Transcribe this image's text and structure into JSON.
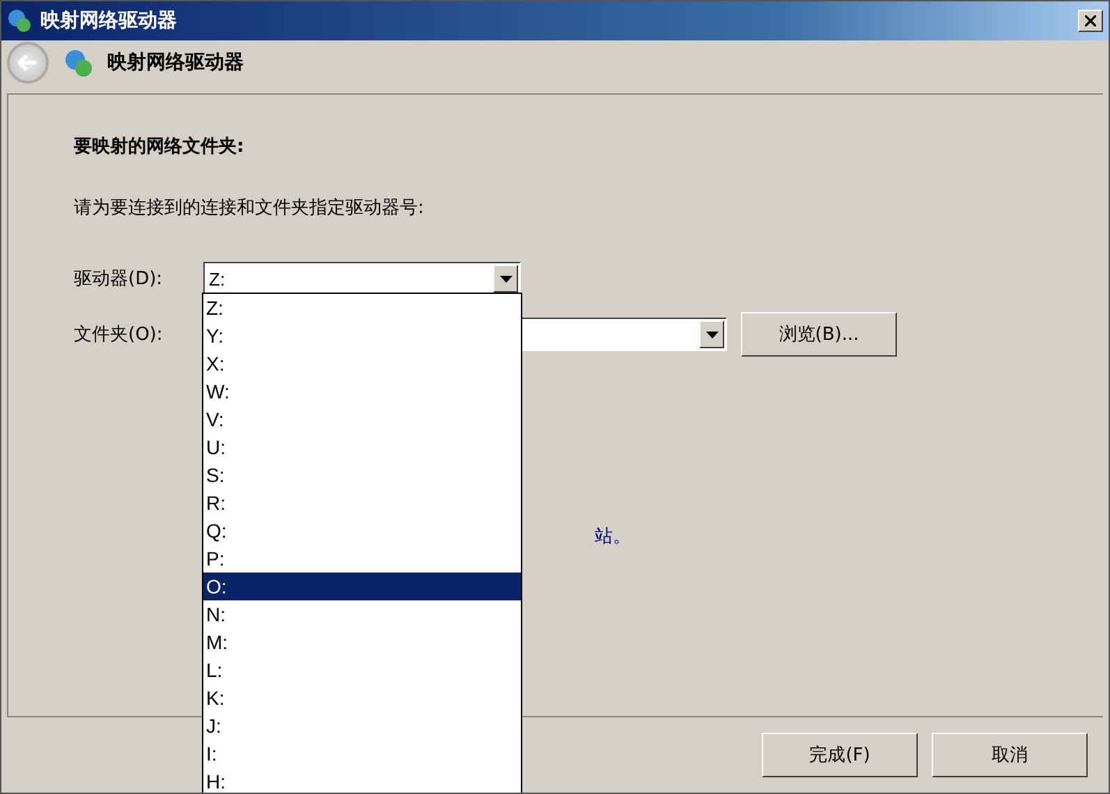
{
  "window": {
    "title": "映射网络驱动器"
  },
  "header": {
    "title": "映射网络驱动器"
  },
  "heading": "要映射的网络文件夹:",
  "instruction": "请为要连接到的连接和文件夹指定驱动器号:",
  "drive": {
    "label": "驱动器(D):",
    "value": "Z:",
    "expanded": true
  },
  "folder": {
    "label": "文件夹(O):",
    "browse": "浏览(B)..."
  },
  "link_fragment": "站。",
  "drive_options": [
    {
      "label": "Z:",
      "selected": false
    },
    {
      "label": "Y:",
      "selected": false
    },
    {
      "label": "X:",
      "selected": false
    },
    {
      "label": "W:",
      "selected": false
    },
    {
      "label": "V:",
      "selected": false
    },
    {
      "label": "U:",
      "selected": false
    },
    {
      "label": "S:",
      "selected": false
    },
    {
      "label": "R:",
      "selected": false
    },
    {
      "label": "Q:",
      "selected": false
    },
    {
      "label": "P:",
      "selected": false
    },
    {
      "label": "O:",
      "selected": true
    },
    {
      "label": "N:",
      "selected": false
    },
    {
      "label": "M:",
      "selected": false
    },
    {
      "label": "L:",
      "selected": false
    },
    {
      "label": "K:",
      "selected": false
    },
    {
      "label": "J:",
      "selected": false
    },
    {
      "label": "I:",
      "selected": false
    },
    {
      "label": "H:",
      "selected": false
    }
  ],
  "buttons": [
    "完成(F)",
    "取消"
  ]
}
